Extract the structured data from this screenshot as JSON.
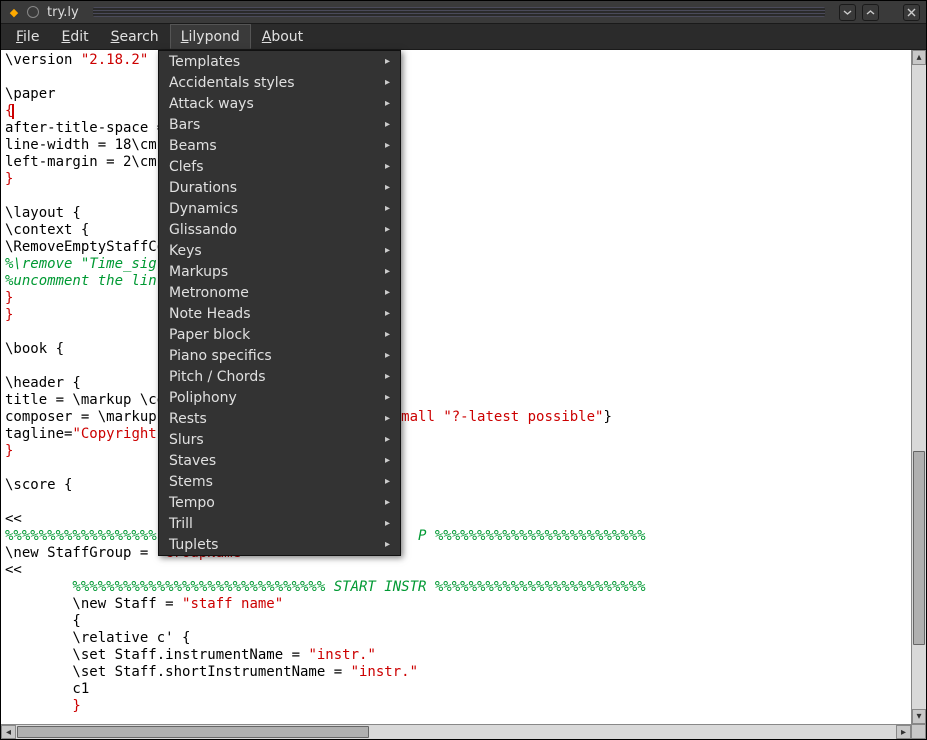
{
  "window": {
    "title": "try.ly"
  },
  "menubar": {
    "file": "File",
    "edit": "Edit",
    "search": "Search",
    "lilypond": "Lilypond",
    "about": "About"
  },
  "dropdown": {
    "items": [
      "Templates",
      "Accidentals styles",
      "Attack ways",
      "Bars",
      "Beams",
      "Clefs",
      "Durations",
      "Dynamics",
      "Glissando",
      "Keys",
      "Markups",
      "Metronome",
      "Note Heads",
      "Paper block",
      "Piano specifics",
      "Pitch / Chords",
      "Poliphony",
      "Rests",
      "Slurs",
      "Staves",
      "Stems",
      "Tempo",
      "Trill",
      "Tuplets"
    ]
  },
  "code": {
    "l1a": "\\version ",
    "l1b": "\"2.18.2\"",
    "l3": "\\paper",
    "l4": "{",
    "l5": "after-title-space =",
    "l6": "line-width = 18\\cm",
    "l7": "left-margin = 2\\cm",
    "l8": "}",
    "l10": "\\layout {",
    "l11": "\\context {",
    "l12": "\\RemoveEmptyStaffCo",
    "l13": "%\\remove \"Time_sig",
    "l14": "%uncomment the lin",
    "l15": "}",
    "l16": "}",
    "l18": "\\book {",
    "l20": "\\header {",
    "l21": "title = \\markup \\ce",
    "l22a": "composer = \\markup ",
    "l22b": "\" \\small ",
    "l22c": "\"?-latest possible\"",
    "l22d": "}",
    "l23a": "tagline=",
    "l23b": "\"Copyright",
    "l24": "}",
    "l26": "\\score {",
    "l28": "<<",
    "l29a": "%%%%%%%%%%%%%%%%%%",
    "l29b": "P %%%%%%%%%%%%%%%%%%%%%%%%%",
    "l30a": "\\new StaffGroup = ",
    "l30b": "\"GroupName\"",
    "l31": "<<",
    "l32": "        %%%%%%%%%%%%%%%%%%%%%%%%%%%%%% START INSTR %%%%%%%%%%%%%%%%%%%%%%%%%",
    "l33a": "        \\new Staff = ",
    "l33b": "\"staff name\"",
    "l34": "        {",
    "l35": "        \\relative c' {",
    "l36a": "        \\set Staff.instrumentName = ",
    "l36b": "\"instr.\"",
    "l37a": "        \\set Staff.shortInstrumentName = ",
    "l37b": "\"instr.\"",
    "l38": "        c1",
    "l39": "        }"
  }
}
